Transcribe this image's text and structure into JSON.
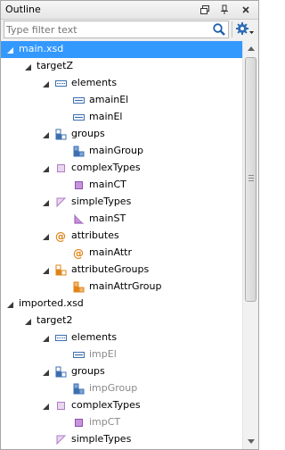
{
  "panel": {
    "title": "Outline",
    "restore_icon": "restore-icon",
    "pin_icon": "pin-icon",
    "close_icon": "close-icon"
  },
  "filter": {
    "placeholder": "Type filter text",
    "value": ""
  },
  "tree": [
    {
      "label": "main.xsd",
      "level": 0,
      "icon": "none",
      "selected": true,
      "gray": false
    },
    {
      "label": "targetZ",
      "level": 1,
      "icon": "none",
      "selected": false,
      "gray": false
    },
    {
      "label": "elements",
      "level": 2,
      "icon": "elements-icon",
      "selected": false,
      "gray": false
    },
    {
      "label": "amainEl",
      "level": 3,
      "icon": "element-icon",
      "selected": false,
      "gray": false
    },
    {
      "label": "mainEl",
      "level": 3,
      "icon": "element-icon",
      "selected": false,
      "gray": false
    },
    {
      "label": "groups",
      "level": 2,
      "icon": "groups-icon",
      "selected": false,
      "gray": false
    },
    {
      "label": "mainGroup",
      "level": 3,
      "icon": "group-icon",
      "selected": false,
      "gray": false
    },
    {
      "label": "complexTypes",
      "level": 2,
      "icon": "complex-types-icon",
      "selected": false,
      "gray": false
    },
    {
      "label": "mainCT",
      "level": 3,
      "icon": "complex-type-icon",
      "selected": false,
      "gray": false
    },
    {
      "label": "simpleTypes",
      "level": 2,
      "icon": "simple-types-icon",
      "selected": false,
      "gray": false
    },
    {
      "label": "mainST",
      "level": 3,
      "icon": "simple-type-icon",
      "selected": false,
      "gray": false
    },
    {
      "label": "attributes",
      "level": 2,
      "icon": "attributes-icon",
      "selected": false,
      "gray": false
    },
    {
      "label": "mainAttr",
      "level": 3,
      "icon": "attribute-icon",
      "selected": false,
      "gray": false
    },
    {
      "label": "attributeGroups",
      "level": 2,
      "icon": "attribute-groups-icon",
      "selected": false,
      "gray": false
    },
    {
      "label": "mainAttrGroup",
      "level": 3,
      "icon": "attribute-group-icon",
      "selected": false,
      "gray": false
    },
    {
      "label": "imported.xsd",
      "level": 0,
      "icon": "none",
      "selected": false,
      "gray": false
    },
    {
      "label": "target2",
      "level": 1,
      "icon": "none",
      "selected": false,
      "gray": false
    },
    {
      "label": "elements",
      "level": 2,
      "icon": "elements-icon",
      "selected": false,
      "gray": false
    },
    {
      "label": "impEl",
      "level": 3,
      "icon": "element-icon",
      "selected": false,
      "gray": true
    },
    {
      "label": "groups",
      "level": 2,
      "icon": "groups-icon",
      "selected": false,
      "gray": false
    },
    {
      "label": "impGroup",
      "level": 3,
      "icon": "group-icon",
      "selected": false,
      "gray": true
    },
    {
      "label": "complexTypes",
      "level": 2,
      "icon": "complex-types-icon",
      "selected": false,
      "gray": false
    },
    {
      "label": "impCT",
      "level": 3,
      "icon": "complex-type-icon",
      "selected": false,
      "gray": true
    },
    {
      "label": "simpleTypes",
      "level": 2,
      "icon": "simple-types-icon",
      "selected": false,
      "gray": false
    }
  ],
  "colors": {
    "selection": "#3399ff",
    "element_blue": "#3d6fb0",
    "complex_purple": "#b07cc6",
    "attribute_orange": "#e0841a"
  }
}
